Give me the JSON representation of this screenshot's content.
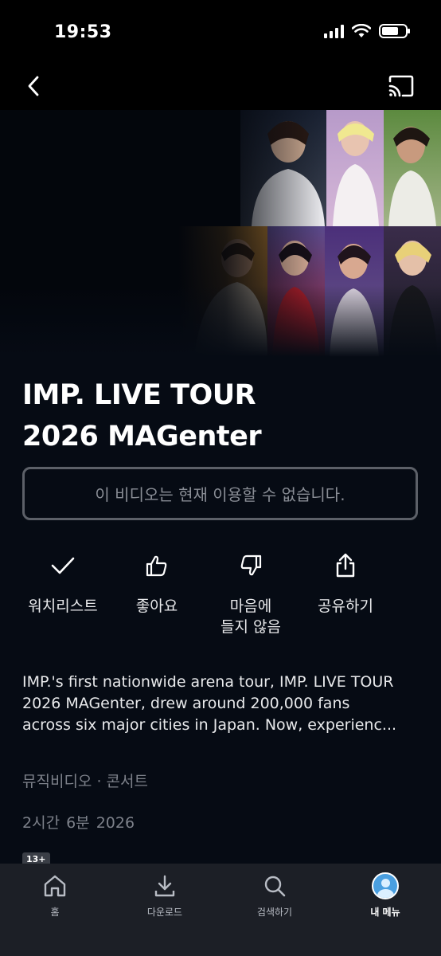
{
  "status_bar": {
    "time": "19:53"
  },
  "icons": {
    "back": "chevron-left-icon",
    "cast": "cast-icon",
    "watchlist": "checkmark-icon",
    "like": "thumbs-up-icon",
    "dislike": "thumbs-down-icon",
    "share": "share-icon",
    "home": "home-icon",
    "downloads": "download-icon",
    "search": "search-icon",
    "my_menu": "avatar-icon"
  },
  "hero": {
    "poster_alt": "IMP. members concert collage"
  },
  "content": {
    "title_line1": "IMP. LIVE TOUR",
    "title_line2": "2026 MAGenter",
    "unavailable": "이 비디오는 현재 이용할 수 없습니다.",
    "description_line1": "IMP.'s first nationwide arena tour, IMP. LIVE TOUR",
    "description_line2": "2026 MAGenter, drew around 200,000 fans",
    "description_line3": "across six major cities in Japan. Now, experienc...",
    "genres": "뮤직비디오 · 콘서트",
    "meta": "2시간 6분  2026",
    "rating": "13+"
  },
  "actions": {
    "watchlist": "워치리스트",
    "like": "좋아요",
    "dislike_line1": "마음에",
    "dislike_line2": "들지 않음",
    "share": "공유하기"
  },
  "tabs": {
    "home": "홈",
    "downloads": "다운로드",
    "search": "검색하기",
    "my_menu": "내 메뉴"
  },
  "colors": {
    "background": "#060b14",
    "tab_bar": "#1c1f26",
    "muted_text": "#7d818a",
    "unavailable_border": "#5c6068",
    "avatar": "#4a9fe0"
  }
}
